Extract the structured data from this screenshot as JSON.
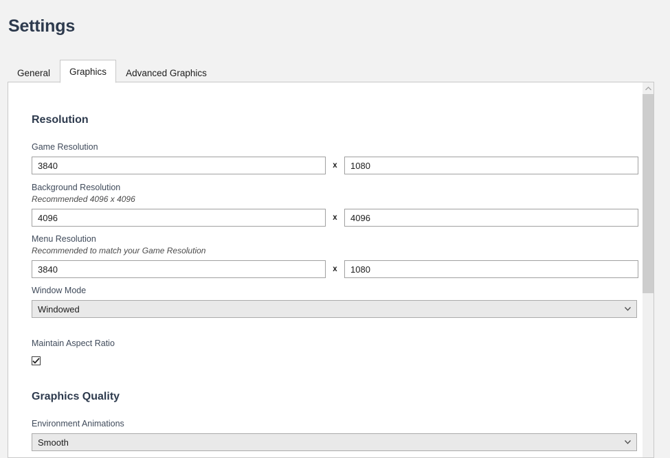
{
  "window": {
    "title": "Settings",
    "background_color": "#f2f2f2",
    "panel_background": "#ffffff",
    "heading_color": "#2d3a4d"
  },
  "tabs": [
    {
      "label": "General",
      "active": false
    },
    {
      "label": "Graphics",
      "active": true
    },
    {
      "label": "Advanced Graphics",
      "active": false
    }
  ],
  "sections": {
    "resolution": {
      "title": "Resolution",
      "fields": {
        "game": {
          "label": "Game Resolution",
          "hint": "",
          "width": "3840",
          "height": "1080",
          "separator": "x"
        },
        "background": {
          "label": "Background Resolution",
          "hint": "Recommended 4096 x 4096",
          "width": "4096",
          "height": "4096",
          "separator": "x"
        },
        "menu": {
          "label": "Menu Resolution",
          "hint": "Recommended to match your Game Resolution",
          "width": "3840",
          "height": "1080",
          "separator": "x"
        },
        "window_mode": {
          "label": "Window Mode",
          "value": "Windowed"
        },
        "maintain_aspect_ratio": {
          "label": "Maintain Aspect Ratio",
          "checked": true,
          "check_glyph": "✔"
        }
      }
    },
    "graphics_quality": {
      "title": "Graphics Quality",
      "fields": {
        "environment_animations": {
          "label": "Environment Animations",
          "value": "Smooth"
        }
      }
    }
  },
  "scrollbar": {
    "up_arrow": "scroll-up",
    "thumb_color": "#cdcdcd",
    "track_color": "#f0f0f0"
  }
}
